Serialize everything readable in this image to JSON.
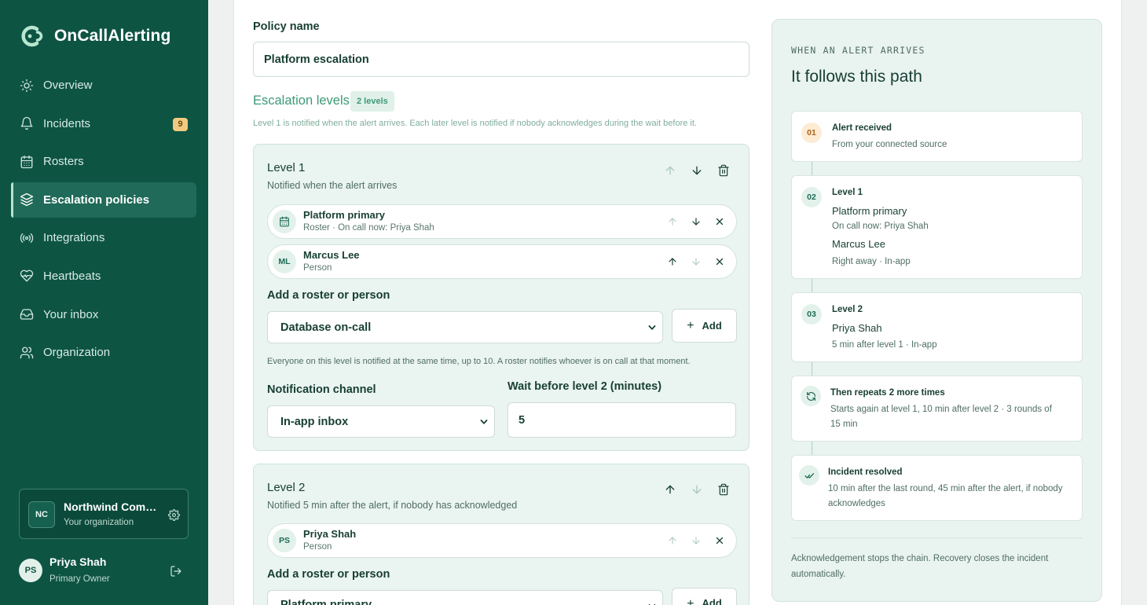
{
  "brand": {
    "name": "OnCallAlerting"
  },
  "sidebar": {
    "items": [
      {
        "label": "Overview",
        "icon": "sun-icon"
      },
      {
        "label": "Incidents",
        "icon": "bell-icon",
        "badge": "9"
      },
      {
        "label": "Rosters",
        "icon": "calendar-icon"
      },
      {
        "label": "Escalation policies",
        "icon": "layers-icon",
        "active": true
      },
      {
        "label": "Integrations",
        "icon": "broadcast-icon"
      },
      {
        "label": "Heartbeats",
        "icon": "heart-pulse-icon"
      },
      {
        "label": "Your inbox",
        "icon": "inbox-icon"
      },
      {
        "label": "Organization",
        "icon": "users-icon"
      }
    ],
    "org": {
      "initials": "NC",
      "name": "Northwind Com…",
      "subtitle": "Your organization"
    },
    "user": {
      "initials": "PS",
      "name": "Priya Shah",
      "role": "Primary Owner"
    }
  },
  "form": {
    "policy_name_label": "Policy name",
    "policy_name_value": "Platform escalation",
    "levels_title": "Escalation levels",
    "levels_badge": "2 levels",
    "levels_hint": "Level 1 is notified when the alert arrives. Each later level is notified if nobody acknowledges during the wait before it.",
    "levels": [
      {
        "title": "Level 1",
        "subtitle": "Notified when the alert arrives",
        "members": [
          {
            "name": "Platform primary",
            "sub": "Roster · On call now: Priya Shah",
            "type": "roster"
          },
          {
            "name": "Marcus Lee",
            "sub": "Person",
            "initials": "ML",
            "type": "person"
          }
        ],
        "add_label": "Add a roster or person",
        "add_select": "Database on-call",
        "add_button": "Add",
        "hint": "Everyone on this level is notified at the same time, up to 10. A roster notifies whoever is on call at that moment.",
        "channel_label": "Notification channel",
        "channel_value": "In-app inbox",
        "wait_label": "Wait before level 2 (minutes)",
        "wait_value": "5"
      },
      {
        "title": "Level 2",
        "subtitle": "Notified 5 min after the alert, if nobody has acknowledged",
        "members": [
          {
            "name": "Priya Shah",
            "sub": "Person",
            "initials": "PS",
            "type": "person"
          }
        ],
        "add_label": "Add a roster or person",
        "add_select": "Platform primary",
        "add_button": "Add"
      }
    ]
  },
  "flow": {
    "kicker": "WHEN AN ALERT ARRIVES",
    "title": "It follows this path",
    "steps": [
      {
        "num": "01",
        "title": "Alert received",
        "lines": [
          "From your connected source"
        ]
      },
      {
        "num": "02",
        "title": "Level 1",
        "lines": [
          "Platform primary",
          "On call now: Priya Shah",
          "Marcus Lee",
          "Right away · In-app"
        ]
      },
      {
        "num": "03",
        "title": "Level 2",
        "lines": [
          "Priya Shah",
          "5 min after level 1 · In-app"
        ]
      },
      {
        "icon": "repeat-icon",
        "title": "Then repeats 2 more times",
        "lines": [
          "Starts again at level 1, 10 min after level 2 · 3 rounds of",
          "15 min"
        ]
      },
      {
        "icon": "check-double-icon",
        "title": "Incident resolved",
        "lines": [
          "10 min after the last round, 45 min after the alert, if nobody",
          "acknowledges"
        ]
      }
    ],
    "footer": "Acknowledgement stops the chain. Recovery closes the incident automatically."
  },
  "colors": {
    "sidebar": "#0e5443",
    "accent": "#3d9a78",
    "badge": "#f2c980",
    "panel": "#e9f3f0"
  }
}
